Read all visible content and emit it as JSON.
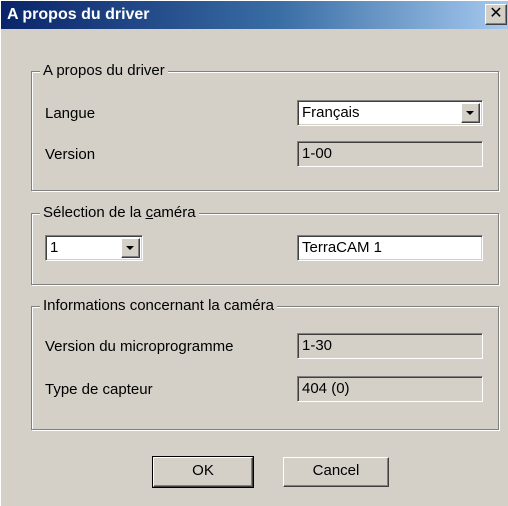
{
  "window": {
    "title": "A propos du driver",
    "close_glyph": "✕"
  },
  "group_about": {
    "legend": "A propos du driver",
    "language_label": "Langue",
    "language_value": "Français",
    "version_label": "Version",
    "version_value": "1-00"
  },
  "group_camera_select": {
    "legend_pre": "Sélection de la ",
    "legend_accel": "c",
    "legend_post": "améra",
    "camera_index_value": "1",
    "camera_name_value": "TerraCAM 1"
  },
  "group_camera_info": {
    "legend": "Informations concernant la caméra",
    "firmware_label": "Version du microprogramme",
    "firmware_value": "1-30",
    "sensor_label": "Type de capteur",
    "sensor_value": "404 (0)"
  },
  "buttons": {
    "ok": "OK",
    "cancel": "Cancel"
  }
}
